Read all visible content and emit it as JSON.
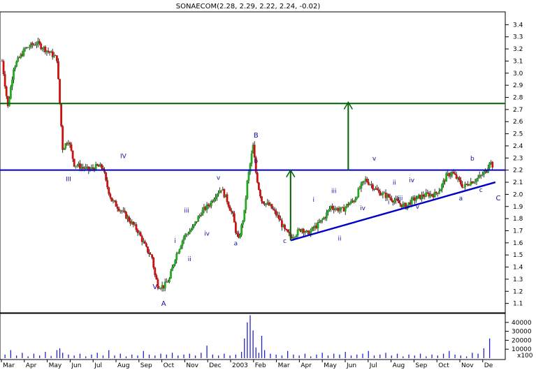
{
  "chart_data": {
    "type": "candlestick",
    "title": "SONAECOM(2.28, 2.29, 2.22, 2.24, -0.02)",
    "price_axis": {
      "ylim": [
        1.0,
        3.5
      ],
      "ticks": [
        "3.4",
        "3.3",
        "3.2",
        "3.1",
        "3.0",
        "2.9",
        "2.8",
        "2.7",
        "2.6",
        "2.5",
        "2.4",
        "2.3",
        "2.2",
        "2.1",
        "2.0",
        "1.9",
        "1.8",
        "1.7",
        "1.6",
        "1.5",
        "1.4",
        "1.3",
        "1.2",
        "1.1"
      ]
    },
    "volume_axis": {
      "ylim": [
        0,
        50000
      ],
      "ticks": [
        "40000",
        "30000",
        "20000",
        "10000"
      ],
      "unit_label": "x100"
    },
    "months": [
      "Mar",
      "Apr",
      "May",
      "Jun",
      "Jul",
      "Aug",
      "Sep",
      "Oct",
      "Nov",
      "Dec",
      "2003",
      "Feb",
      "Mar",
      "Apr",
      "May",
      "Jun",
      "Jul",
      "Aug",
      "Sep",
      "Oct",
      "Nov",
      "De"
    ],
    "close_path": [
      [
        0,
        3.1
      ],
      [
        2,
        2.72
      ],
      [
        4,
        3.05
      ],
      [
        8,
        3.2
      ],
      [
        12,
        3.25
      ],
      [
        16,
        3.18
      ],
      [
        19,
        3.12
      ],
      [
        20,
        2.75
      ],
      [
        21,
        2.38
      ],
      [
        23,
        2.45
      ],
      [
        25,
        2.25
      ],
      [
        28,
        2.22
      ],
      [
        30,
        2.2
      ],
      [
        33,
        2.23
      ],
      [
        35,
        2.22
      ],
      [
        36,
        2.1
      ],
      [
        38,
        1.95
      ],
      [
        40,
        1.9
      ],
      [
        43,
        1.82
      ],
      [
        47,
        1.7
      ],
      [
        50,
        1.55
      ],
      [
        52,
        1.48
      ],
      [
        53,
        1.33
      ],
      [
        54,
        1.25
      ],
      [
        56,
        1.24
      ],
      [
        58,
        1.3
      ],
      [
        60,
        1.48
      ],
      [
        63,
        1.65
      ],
      [
        66,
        1.72
      ],
      [
        69,
        1.85
      ],
      [
        72,
        1.92
      ],
      [
        74,
        2.0
      ],
      [
        76,
        2.05
      ],
      [
        78,
        1.95
      ],
      [
        80,
        1.82
      ],
      [
        81,
        1.7
      ],
      [
        82,
        1.62
      ],
      [
        84,
        1.85
      ],
      [
        85,
        2.1
      ],
      [
        86,
        2.25
      ],
      [
        87,
        2.4
      ],
      [
        88,
        2.18
      ],
      [
        89,
        2.05
      ],
      [
        90,
        1.95
      ],
      [
        93,
        1.9
      ],
      [
        96,
        1.8
      ],
      [
        98,
        1.7
      ],
      [
        100,
        1.65
      ],
      [
        102,
        1.68
      ],
      [
        104,
        1.72
      ],
      [
        106,
        1.67
      ],
      [
        108,
        1.72
      ],
      [
        110,
        1.76
      ],
      [
        112,
        1.82
      ],
      [
        114,
        1.9
      ],
      [
        116,
        1.88
      ],
      [
        118,
        1.87
      ],
      [
        120,
        1.92
      ],
      [
        122,
        1.95
      ],
      [
        124,
        2.05
      ],
      [
        126,
        2.12
      ],
      [
        128,
        2.08
      ],
      [
        130,
        2.03
      ],
      [
        132,
        2.0
      ],
      [
        134,
        1.98
      ],
      [
        136,
        1.95
      ],
      [
        138,
        1.92
      ],
      [
        140,
        1.9
      ],
      [
        142,
        1.95
      ],
      [
        144,
        1.97
      ],
      [
        146,
        1.99
      ],
      [
        148,
        2.0
      ],
      [
        150,
        2.0
      ],
      [
        152,
        2.05
      ],
      [
        154,
        2.15
      ],
      [
        156,
        2.18
      ],
      [
        158,
        2.12
      ],
      [
        160,
        2.06
      ],
      [
        162,
        2.1
      ],
      [
        164,
        2.12
      ],
      [
        166,
        2.15
      ],
      [
        168,
        2.2
      ],
      [
        169,
        2.28
      ],
      [
        170,
        2.24
      ]
    ],
    "volume_bars": [
      [
        1,
        4000
      ],
      [
        3,
        9000
      ],
      [
        5,
        3000
      ],
      [
        7,
        6000
      ],
      [
        9,
        2000
      ],
      [
        11,
        5000
      ],
      [
        13,
        3000
      ],
      [
        15,
        7000
      ],
      [
        17,
        2500
      ],
      [
        19,
        9000
      ],
      [
        20,
        11000
      ],
      [
        21,
        6000
      ],
      [
        23,
        4000
      ],
      [
        25,
        3000
      ],
      [
        27,
        5000
      ],
      [
        29,
        2000
      ],
      [
        31,
        4000
      ],
      [
        33,
        6000
      ],
      [
        35,
        3000
      ],
      [
        37,
        9000
      ],
      [
        39,
        3000
      ],
      [
        41,
        5000
      ],
      [
        43,
        2000
      ],
      [
        45,
        4000
      ],
      [
        47,
        3000
      ],
      [
        49,
        8000
      ],
      [
        51,
        4000
      ],
      [
        53,
        3000
      ],
      [
        55,
        5000
      ],
      [
        57,
        4000
      ],
      [
        59,
        6000
      ],
      [
        61,
        3000
      ],
      [
        63,
        4000
      ],
      [
        65,
        5000
      ],
      [
        67,
        3000
      ],
      [
        69,
        6000
      ],
      [
        71,
        14000
      ],
      [
        73,
        4000
      ],
      [
        75,
        3000
      ],
      [
        77,
        5000
      ],
      [
        79,
        3000
      ],
      [
        81,
        4000
      ],
      [
        83,
        7000
      ],
      [
        84,
        22000
      ],
      [
        85,
        40000
      ],
      [
        86,
        48000
      ],
      [
        87,
        31000
      ],
      [
        88,
        12000
      ],
      [
        89,
        6000
      ],
      [
        90,
        25000
      ],
      [
        91,
        9000
      ],
      [
        93,
        5000
      ],
      [
        95,
        4000
      ],
      [
        97,
        3000
      ],
      [
        99,
        8000
      ],
      [
        101,
        4000
      ],
      [
        103,
        3000
      ],
      [
        105,
        5000
      ],
      [
        107,
        2000
      ],
      [
        109,
        4000
      ],
      [
        111,
        6000
      ],
      [
        113,
        3000
      ],
      [
        115,
        5000
      ],
      [
        117,
        4000
      ],
      [
        119,
        7000
      ],
      [
        121,
        3000
      ],
      [
        123,
        4000
      ],
      [
        125,
        5000
      ],
      [
        127,
        8000
      ],
      [
        129,
        3000
      ],
      [
        131,
        4000
      ],
      [
        133,
        6000
      ],
      [
        135,
        3000
      ],
      [
        137,
        5000
      ],
      [
        139,
        2000
      ],
      [
        141,
        4000
      ],
      [
        143,
        3000
      ],
      [
        145,
        5000
      ],
      [
        147,
        2000
      ],
      [
        149,
        4000
      ],
      [
        151,
        3000
      ],
      [
        153,
        5000
      ],
      [
        155,
        8000
      ],
      [
        157,
        4000
      ],
      [
        159,
        3000
      ],
      [
        161,
        2000
      ],
      [
        163,
        6000
      ],
      [
        165,
        5000
      ],
      [
        167,
        11000
      ],
      [
        169,
        22000
      ]
    ],
    "horizontal_lines": [
      {
        "value": 2.75,
        "color": "#006400"
      },
      {
        "value": 2.2,
        "color": "#0000c8"
      }
    ],
    "trendline": {
      "from": [
        100,
        1.62
      ],
      "to": [
        171,
        2.1
      ],
      "color": "#0000c8"
    },
    "target_arrows": [
      {
        "x": 100,
        "from": 1.62,
        "to": 2.2,
        "color": "#006400"
      },
      {
        "x": 120,
        "from": 2.2,
        "to": 2.76,
        "color": "#006400"
      }
    ],
    "wave_labels": [
      {
        "text": "III",
        "x": 23,
        "y": 2.11
      },
      {
        "text": "IV",
        "x": 42,
        "y": 2.3
      },
      {
        "text": "V",
        "x": 53,
        "y": 1.22
      },
      {
        "text": "A",
        "x": 56,
        "y": 1.08
      },
      {
        "text": "i",
        "x": 60,
        "y": 1.6
      },
      {
        "text": "ii",
        "x": 65,
        "y": 1.45
      },
      {
        "text": "iii",
        "x": 64,
        "y": 1.85
      },
      {
        "text": "iv",
        "x": 71,
        "y": 1.66
      },
      {
        "text": "v",
        "x": 75,
        "y": 2.12
      },
      {
        "text": "a",
        "x": 81,
        "y": 1.58
      },
      {
        "text": "B",
        "x": 88,
        "y": 2.47
      },
      {
        "text": "b",
        "x": 88,
        "y": 2.26
      },
      {
        "text": "c",
        "x": 98,
        "y": 1.6
      },
      {
        "text": "i",
        "x": 108,
        "y": 1.94
      },
      {
        "text": "ii",
        "x": 117,
        "y": 1.62
      },
      {
        "text": "iii",
        "x": 115,
        "y": 2.01
      },
      {
        "text": "iv",
        "x": 125,
        "y": 1.87
      },
      {
        "text": "v",
        "x": 129,
        "y": 2.28
      },
      {
        "text": "i",
        "x": 134,
        "y": 1.92
      },
      {
        "text": "ii",
        "x": 136,
        "y": 2.08
      },
      {
        "text": "iii",
        "x": 138,
        "y": 1.95
      },
      {
        "text": "iv",
        "x": 142,
        "y": 2.1
      },
      {
        "text": "v",
        "x": 144,
        "y": 1.88
      },
      {
        "text": "a",
        "x": 159,
        "y": 1.95
      },
      {
        "text": "b",
        "x": 163,
        "y": 2.28
      },
      {
        "text": "c",
        "x": 166,
        "y": 2.02
      },
      {
        "text": "C",
        "x": 172,
        "y": 1.95
      }
    ],
    "grid": false
  }
}
